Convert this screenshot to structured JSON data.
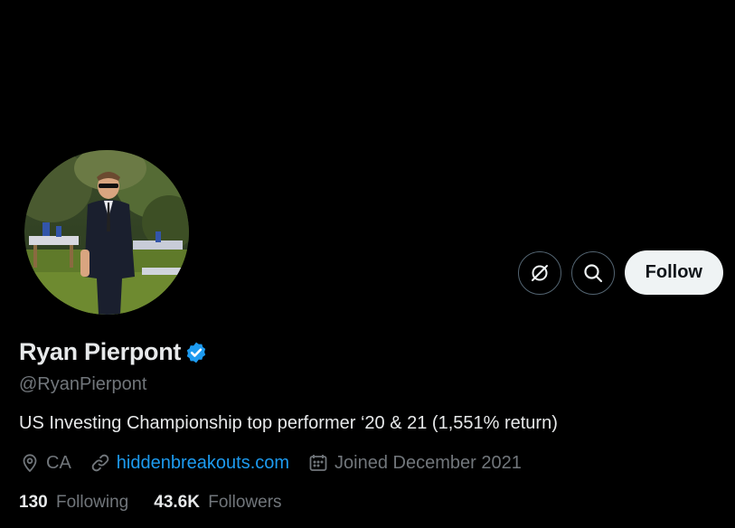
{
  "profile": {
    "display_name": "Ryan Pierpont",
    "handle": "@RyanPierpont",
    "verified": true,
    "bio": "US Investing Championship top performer ‘20 & 21 (1,551% return)",
    "location": "CA",
    "website": "hiddenbreakouts.com",
    "joined": "Joined December 2021"
  },
  "stats": {
    "following_count": "130",
    "following_label": "Following",
    "followers_count": "43.6K",
    "followers_label": "Followers"
  },
  "actions": {
    "follow_label": "Follow",
    "grok_icon": "grok-icon",
    "search_icon": "search-icon"
  },
  "colors": {
    "background": "#000000",
    "primary_text": "#e7e9ea",
    "secondary_text": "#71767b",
    "link": "#1d9bf0",
    "verified": "#1d9bf0",
    "follow_button_bg": "#eff3f4"
  }
}
